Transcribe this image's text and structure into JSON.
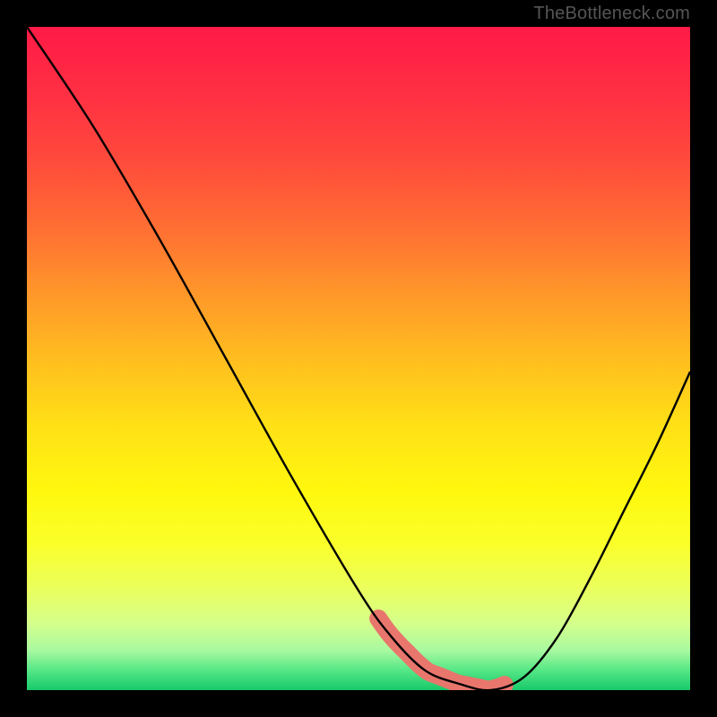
{
  "watermark": "TheBottleneck.com",
  "gradient": {
    "stops": [
      {
        "offset": 0.0,
        "color": "#ff1a47"
      },
      {
        "offset": 0.1,
        "color": "#ff2f43"
      },
      {
        "offset": 0.2,
        "color": "#ff4a3c"
      },
      {
        "offset": 0.3,
        "color": "#ff6d33"
      },
      {
        "offset": 0.4,
        "color": "#ff962a"
      },
      {
        "offset": 0.5,
        "color": "#ffbd1f"
      },
      {
        "offset": 0.6,
        "color": "#ffe016"
      },
      {
        "offset": 0.7,
        "color": "#fff80e"
      },
      {
        "offset": 0.78,
        "color": "#faff2a"
      },
      {
        "offset": 0.85,
        "color": "#eaff60"
      },
      {
        "offset": 0.9,
        "color": "#d4ff8c"
      },
      {
        "offset": 0.94,
        "color": "#a9f9a0"
      },
      {
        "offset": 0.97,
        "color": "#55e786"
      },
      {
        "offset": 1.0,
        "color": "#18c96b"
      }
    ]
  },
  "chart_data": {
    "type": "line",
    "title": "",
    "xlabel": "",
    "ylabel": "",
    "xlim": [
      0,
      100
    ],
    "ylim": [
      0,
      100
    ],
    "series": [
      {
        "name": "bottleneck-curve",
        "x": [
          0,
          10,
          20,
          30,
          40,
          50,
          55,
          60,
          65,
          70,
          75,
          80,
          85,
          90,
          95,
          100
        ],
        "values": [
          100,
          85,
          68,
          50,
          32,
          15,
          8,
          3,
          1,
          0,
          2,
          8,
          17,
          27,
          37,
          48
        ]
      }
    ],
    "highlight_band": {
      "name": "optimal-range",
      "x_start": 53,
      "x_end": 72,
      "color": "#e8766d"
    }
  }
}
